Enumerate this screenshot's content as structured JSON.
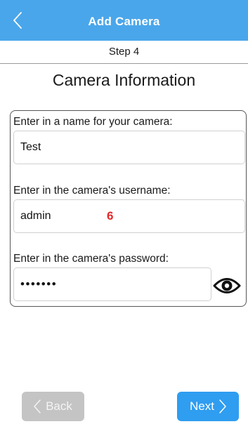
{
  "header": {
    "title": "Add Camera",
    "back_icon": "chevron-left-icon",
    "background_color": "#4aa6ea"
  },
  "step": "Step 4",
  "section_title": "Camera Information",
  "form": {
    "name_label": "Enter in a name for your camera:",
    "name_value": "Test",
    "username_label": "Enter in the camera's username:",
    "username_value": "admin",
    "password_label": "Enter in the camera's password:",
    "password_value": "•••••••",
    "password_toggle_icon": "eye-icon"
  },
  "annotation": {
    "text": "6",
    "color": "#e52727"
  },
  "footer": {
    "back_label": "Back",
    "back_enabled": false,
    "next_label": "Next",
    "accent_color": "#2f9df0"
  }
}
